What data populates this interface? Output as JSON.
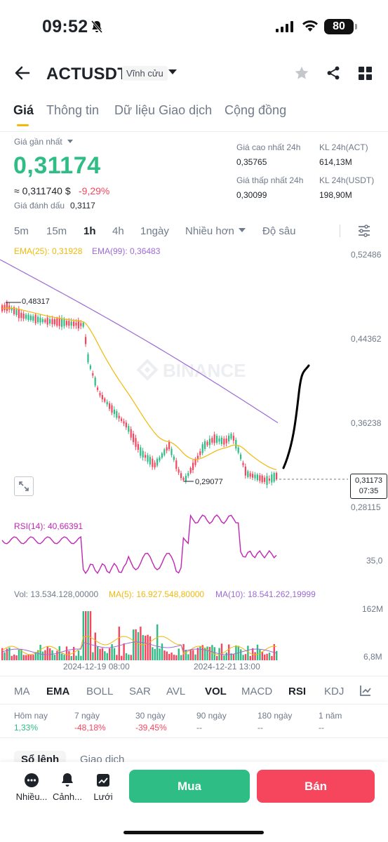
{
  "status_bar": {
    "time": "09:52",
    "battery": "80"
  },
  "header": {
    "pair": "ACTUSDT",
    "contract_type": "Vĩnh cửu"
  },
  "tabs": [
    "Giá",
    "Thông tin",
    "Dữ liệu Giao dịch",
    "Cộng đồng"
  ],
  "price": {
    "last_label": "Giá gần nhất",
    "last": "0,31174",
    "approx": "≈ 0,311740 $",
    "change": "-9,29%",
    "mark_label": "Giá đánh dấu",
    "mark": "0,3117",
    "high_label": "Giá cao nhất 24h",
    "high": "0,35765",
    "low_label": "Giá thấp nhất 24h",
    "low": "0,30099",
    "vol_act_label": "KL 24h(ACT)",
    "vol_act": "614,13M",
    "vol_usdt_label": "KL 24h(USDT)",
    "vol_usdt": "198,90M"
  },
  "timeframes": [
    "5m",
    "15m",
    "1h",
    "4h",
    "1ngày",
    "Nhiều hơn",
    "Độ sâu"
  ],
  "active_timeframe": "1h",
  "chart": {
    "ema25_label": "EMA(25): 0,31928",
    "ema99_label": "EMA(99): 0,36483",
    "price_ticks": [
      "0,52486",
      "0,44362",
      "0,36238",
      "0,28115"
    ],
    "current_tag_price": "0,31173",
    "current_tag_time": "07:35",
    "high_marker": "0,48317",
    "low_marker": "0,29077",
    "watermark": "BINANCE",
    "rsi_label": "RSI(14): 40,66391",
    "rsi_tick": "35,0",
    "vol_label": "Vol: 13.534.128,00000",
    "vol_ma5_label": "MA(5): 16.927.548,80000",
    "vol_ma10_label": "MA(10): 18.541.262,19999",
    "vol_ticks": [
      "162M",
      "6,8M"
    ],
    "dates": [
      "2024-12-19 08:00",
      "2024-12-21 13:00"
    ],
    "colors": {
      "up": "#2ebd85",
      "down": "#f6465d",
      "ema25": "#f0b90b",
      "ema99": "#9c6ad6",
      "rsi": "#c026b5"
    }
  },
  "indicators": [
    "MA",
    "EMA",
    "BOLL",
    "SAR",
    "AVL",
    "VOL",
    "MACD",
    "RSI",
    "KDJ"
  ],
  "active_indicators": [
    "EMA",
    "VOL",
    "RSI"
  ],
  "performance": [
    {
      "label": "Hôm nay",
      "value": "1,33%",
      "color": "#2ebd85"
    },
    {
      "label": "7 ngày",
      "value": "-48,18%",
      "color": "#f6465d"
    },
    {
      "label": "30 ngày",
      "value": "-39,45%",
      "color": "#f6465d"
    },
    {
      "label": "90 ngày",
      "value": "--",
      "color": "#707a8a"
    },
    {
      "label": "180 ngày",
      "value": "--",
      "color": "#707a8a"
    },
    {
      "label": "1 năm",
      "value": "--",
      "color": "#707a8a"
    }
  ],
  "orderbook_tabs": [
    "Sổ lệnh",
    "Giao dịch"
  ],
  "bottom_nav": [
    "Nhiều...",
    "Cảnh...",
    "Lưới"
  ],
  "actions": {
    "buy": "Mua",
    "sell": "Bán"
  }
}
